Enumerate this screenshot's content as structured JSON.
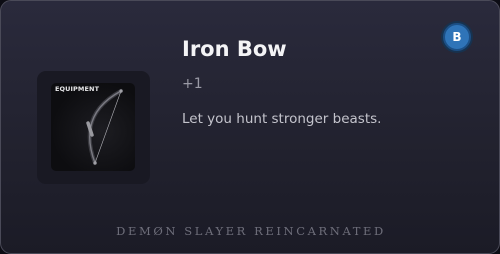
{
  "item": {
    "name": "Iron Bow",
    "modifier": "+1",
    "description": "Let you hunt stronger beasts.",
    "category_tag": "EQUIPMENT",
    "icon": "bow-icon"
  },
  "controls": {
    "button_label": "B",
    "button_color": "#2f74b8"
  },
  "footer": {
    "game_title": "DEMØN SLAYER REINCARNATED"
  }
}
